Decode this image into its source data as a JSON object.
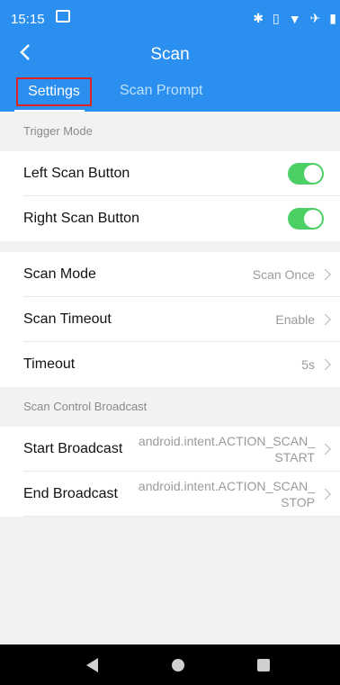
{
  "status_bar": {
    "time": "15:15",
    "icons": [
      "bluetooth-icon",
      "vibrate-icon",
      "wifi-icon",
      "airplane-icon",
      "battery-icon"
    ]
  },
  "app_bar": {
    "title": "Scan",
    "tabs": [
      {
        "label": "Settings",
        "selected": true
      },
      {
        "label": "Scan Prompt",
        "selected": false
      }
    ]
  },
  "trigger_mode": {
    "header": "Trigger Mode",
    "rows": [
      {
        "label": "Left Scan Button",
        "enabled": true
      },
      {
        "label": "Right Scan Button",
        "enabled": true
      }
    ]
  },
  "scan_settings": {
    "rows": [
      {
        "label": "Scan Mode",
        "value": "Scan Once"
      },
      {
        "label": "Scan Timeout",
        "value": "Enable"
      },
      {
        "label": "Timeout",
        "value": "5s"
      }
    ]
  },
  "broadcast": {
    "header": "Scan Control Broadcast",
    "rows": [
      {
        "label": "Start Broadcast",
        "value_line1": "android.intent.ACTION_SCAN_",
        "value_line2": "START"
      },
      {
        "label": "End Broadcast",
        "value_line1": "android.intent.ACTION_SCAN_",
        "value_line2": "STOP"
      }
    ]
  },
  "colors": {
    "primary": "#2b8ff0",
    "toggle_on": "#4cd065",
    "highlight_box": "#e02020"
  }
}
